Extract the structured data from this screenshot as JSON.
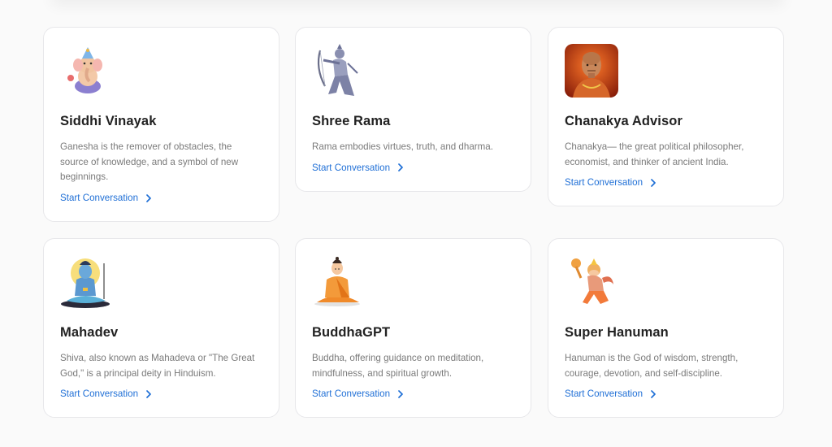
{
  "cards": [
    {
      "title": "Siddhi Vinayak",
      "description": "Ganesha is the remover of obstacles, the source of knowledge, and a symbol of new beginnings.",
      "cta": "Start Conversation",
      "icon": "ganesha-icon"
    },
    {
      "title": "Shree Rama",
      "description": "Rama embodies virtues, truth, and dharma.",
      "cta": "Start Conversation",
      "icon": "rama-icon"
    },
    {
      "title": "Chanakya Advisor",
      "description": "Chanakya— the great political philosopher, economist, and thinker of ancient India.",
      "cta": "Start Conversation",
      "icon": "chanakya-icon"
    },
    {
      "title": "Mahadev",
      "description": "Shiva, also known as Mahadeva or \"The Great God,\" is a principal deity in Hinduism.",
      "cta": "Start Conversation",
      "icon": "shiva-icon"
    },
    {
      "title": "BuddhaGPT",
      "description": "Buddha, offering guidance on meditation, mindfulness, and spiritual growth.",
      "cta": "Start Conversation",
      "icon": "buddha-icon"
    },
    {
      "title": "Super Hanuman",
      "description": "Hanuman is the God of wisdom, strength, courage, devotion, and self-discipline.",
      "cta": "Start Conversation",
      "icon": "hanuman-icon"
    }
  ],
  "colors": {
    "link": "#1f6fd6",
    "title": "#222222",
    "text": "#7a7a7a",
    "border": "#e7e7ea"
  }
}
